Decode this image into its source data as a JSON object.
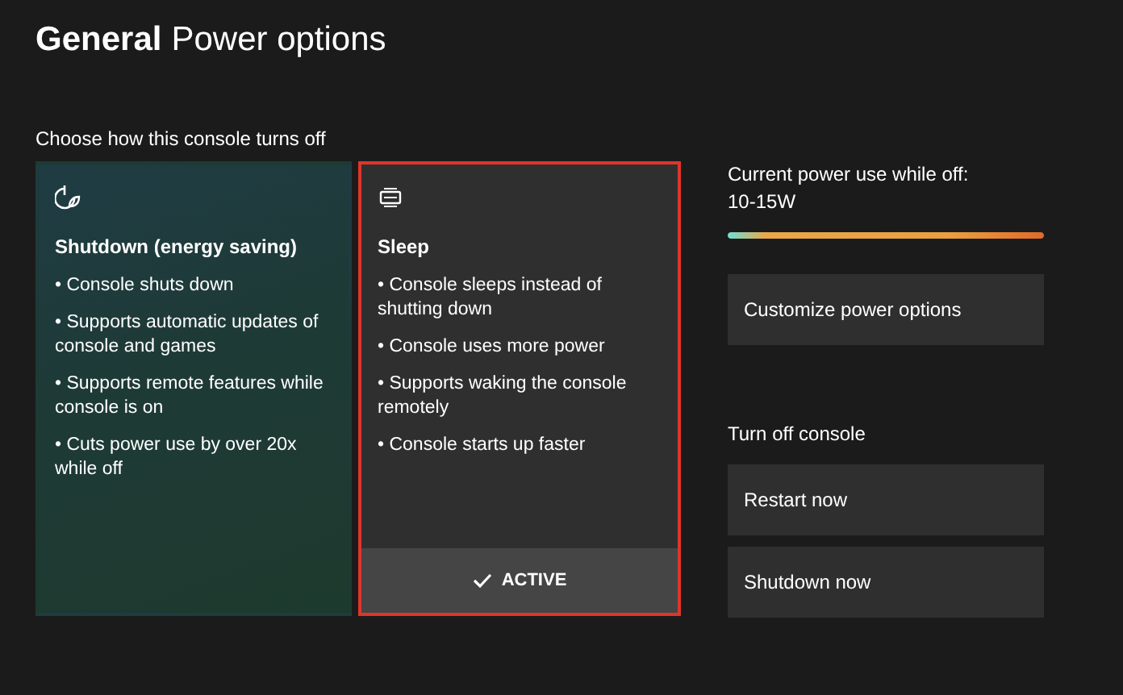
{
  "header": {
    "section": "General",
    "title": "Power options"
  },
  "prompt": "Choose how this console turns off",
  "modes": [
    {
      "kind": "art",
      "title": "Shutdown (energy saving)",
      "bullets": [
        "• Console shuts down",
        "• Supports automatic updates of console and games",
        "• Supports remote features while console is on",
        "• Cuts power use by over 20x while off"
      ],
      "selected": false
    },
    {
      "kind": "plain",
      "title": "Sleep",
      "bullets": [
        "• Console sleeps instead of shutting down",
        "• Console uses more power",
        "• Supports waking the console remotely",
        "• Console starts up faster"
      ],
      "selected": true,
      "status": "ACTIVE"
    }
  ],
  "power_use": {
    "label": "Current power use while off:",
    "value": "10-15W",
    "level": 1
  },
  "customize_button": "Customize power options",
  "turn_off": {
    "heading": "Turn off console",
    "buttons": [
      "Restart now",
      "Shutdown now"
    ]
  }
}
